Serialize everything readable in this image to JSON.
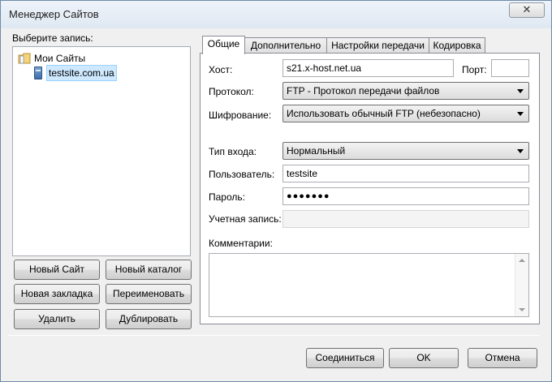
{
  "window": {
    "title": "Менеджер Сайтов",
    "close_glyph": "✕"
  },
  "left": {
    "select_label": "Выберите запись:",
    "tree": {
      "root_label": "Мои Сайты",
      "root_icon": "folder-icon",
      "child_label": "testsite.com.ua",
      "child_icon": "server-icon"
    },
    "buttons": {
      "new_site": "Новый Сайт",
      "new_folder": "Новый каталог",
      "new_bookmark": "Новая закладка",
      "rename": "Переименовать",
      "delete": "Удалить",
      "duplicate": "Дублировать"
    }
  },
  "tabs": {
    "general": "Общие",
    "advanced": "Дополнительно",
    "transfer": "Настройки передачи",
    "charset": "Кодировка",
    "active": "general"
  },
  "form": {
    "host_label": "Хост:",
    "host_value": "s21.x-host.net.ua",
    "port_label": "Порт:",
    "port_value": "",
    "protocol_label": "Протокол:",
    "protocol_value": "FTP - Протокол передачи файлов",
    "encryption_label": "Шифрование:",
    "encryption_value": "Использовать обычный FTP (небезопасно)",
    "logon_label": "Тип входа:",
    "logon_value": "Нормальный",
    "user_label": "Пользователь:",
    "user_value": "testsite",
    "password_label": "Пароль:",
    "password_value": "●●●●●●●",
    "account_label": "Учетная запись:",
    "account_value": "",
    "comments_label": "Комментарии:",
    "comments_value": ""
  },
  "footer": {
    "connect": "Соединиться",
    "ok": "OK",
    "cancel": "Отмена"
  },
  "colors": {
    "selection": "#cde8ff",
    "panel_bg": "#f0f0f0"
  }
}
